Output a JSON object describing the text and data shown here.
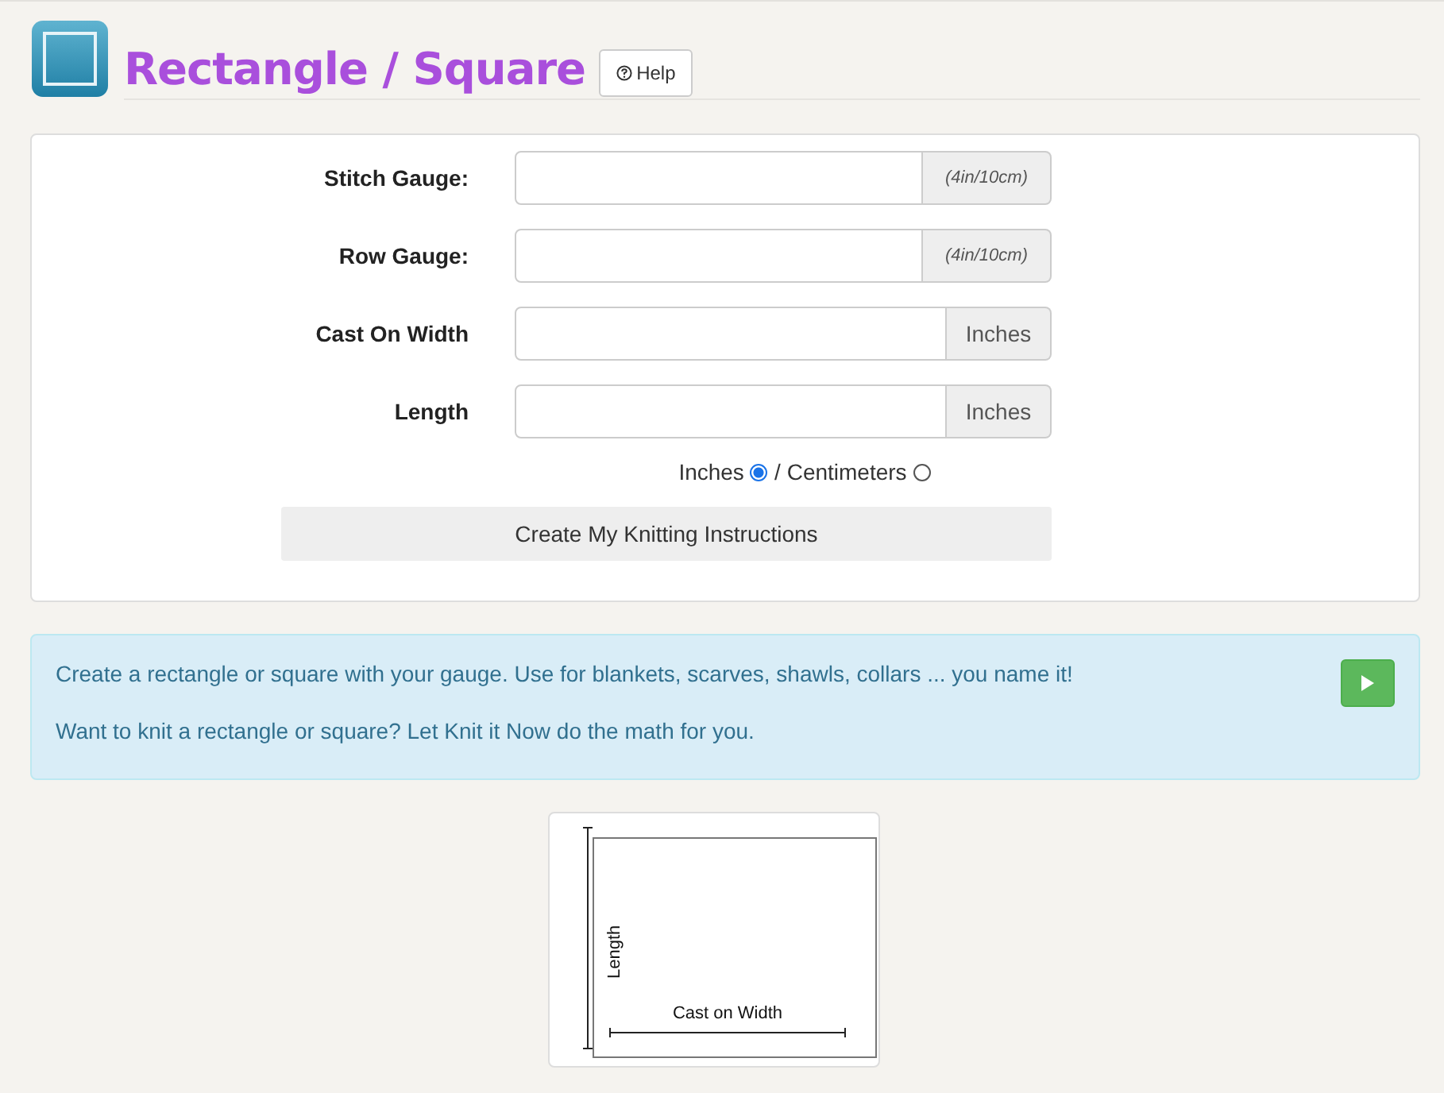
{
  "header": {
    "title": "Rectangle / Square",
    "help_button": "Help"
  },
  "form": {
    "fields": [
      {
        "label": "Stitch Gauge:",
        "addon": "(4in/10cm)",
        "kind": "note"
      },
      {
        "label": "Row Gauge:",
        "addon": "(4in/10cm)",
        "kind": "note"
      },
      {
        "label": "Cast On Width",
        "addon": "Inches",
        "kind": "unit"
      },
      {
        "label": "Length",
        "addon": "Inches",
        "kind": "unit"
      }
    ],
    "units": [
      {
        "label": "Inches",
        "selected": true
      },
      {
        "label": "Centimeters",
        "selected": false
      }
    ],
    "units_separator": "/",
    "submit_button": "Create My Knitting Instructions"
  },
  "info": {
    "paragraphs": [
      "Create a rectangle or square with your gauge. Use for blankets, scarves, shawls, collars ... you name it!",
      "Want to knit a rectangle or square? Let Knit it Now do the math for you."
    ]
  },
  "diagram": {
    "height_label": "Length",
    "width_label": "Cast on Width"
  }
}
